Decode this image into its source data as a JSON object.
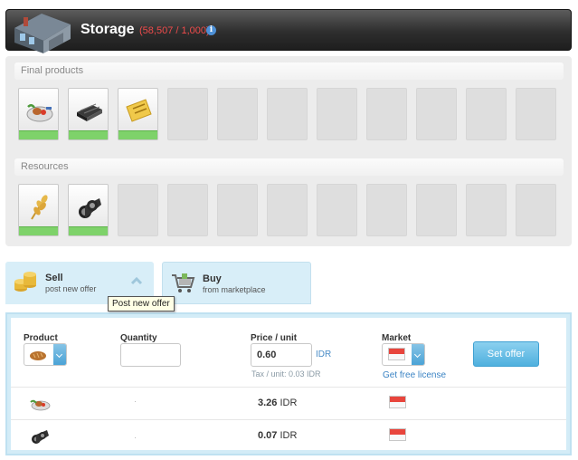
{
  "header": {
    "title": "Storage",
    "capacity": "(58,507 / 1,000)",
    "info_glyph": "i"
  },
  "storage": {
    "final_products_label": "Final products",
    "final_products": [
      {
        "icon": "food-plate-icon"
      },
      {
        "icon": "steel-bars-icon"
      },
      {
        "icon": "ticket-icon"
      }
    ],
    "resources_label": "Resources",
    "resources": [
      {
        "icon": "wheat-icon"
      },
      {
        "icon": "iron-bars-icon"
      }
    ]
  },
  "tabs": {
    "sell": {
      "title": "Sell",
      "subtitle": "post new offer",
      "icon": "coins-icon"
    },
    "buy": {
      "title": "Buy",
      "subtitle": "from marketplace",
      "icon": "shopping-cart-icon"
    }
  },
  "tooltip": "Post new offer",
  "offer_form": {
    "product_label": "Product",
    "quantity_label": "Quantity",
    "quantity_value": "",
    "price_label": "Price / unit",
    "price_value": "0.60",
    "currency": "IDR",
    "tax_text": "Tax / unit: 0.03 IDR",
    "market_label": "Market",
    "license_link": "Get free license",
    "submit_label": "Set offer"
  },
  "offers": [
    {
      "icon": "food-plate-icon",
      "price": "3.26",
      "currency": "IDR",
      "market_flag": "indonesia-flag-icon"
    },
    {
      "icon": "iron-bars-icon",
      "price": "0.07",
      "currency": "IDR",
      "market_flag": "indonesia-flag-icon"
    }
  ],
  "colors": {
    "accent": "#4fb0de",
    "available_bar": "#7ed26a",
    "capacity_text": "#ef4b4b",
    "link": "#3a83c4"
  }
}
